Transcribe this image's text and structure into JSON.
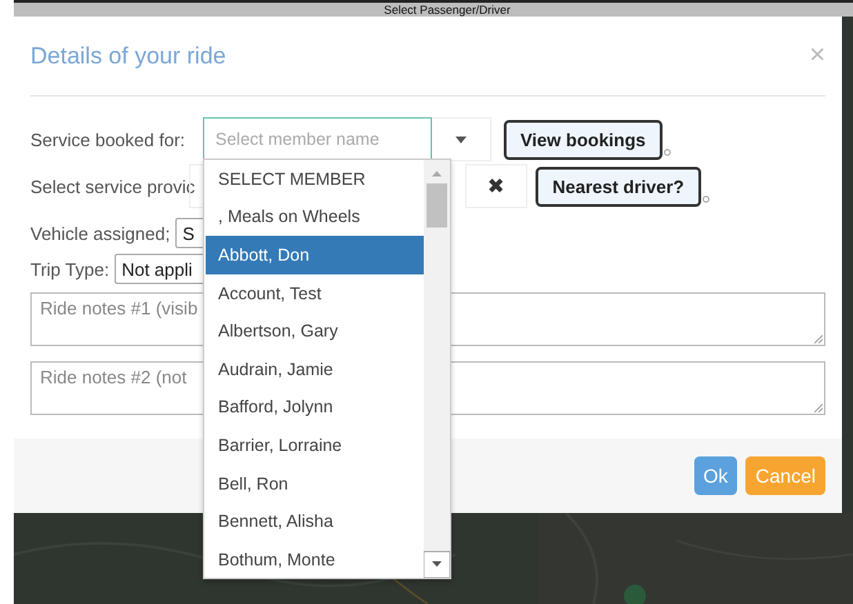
{
  "page_header": {
    "title": "Select Passenger/Driver"
  },
  "dialog": {
    "title": "Details of your ride",
    "close": "×"
  },
  "form": {
    "service_booked_for": {
      "label": "Service booked for:",
      "placeholder": "Select member name"
    },
    "view_bookings": "View bookings",
    "service_provider": {
      "label": "Select service provic",
      "clear": "✖"
    },
    "nearest_driver": "Nearest driver?",
    "vehicle": {
      "label": "Vehicle assigned;",
      "value": "S"
    },
    "trip_type": {
      "label": "Trip Type:",
      "value": "Not appli"
    },
    "notes": [
      {
        "placeholder": "Ride notes #1 (visib"
      },
      {
        "placeholder": "Ride notes #2 (not"
      }
    ]
  },
  "member_dropdown": {
    "items": [
      {
        "label": "SELECT MEMBER",
        "selected": false
      },
      {
        "label": ", Meals on Wheels",
        "selected": false
      },
      {
        "label": "Abbott, Don",
        "selected": true
      },
      {
        "label": "Account, Test",
        "selected": false
      },
      {
        "label": "Albertson, Gary",
        "selected": false
      },
      {
        "label": "Audrain, Jamie",
        "selected": false
      },
      {
        "label": "Bafford, Jolynn",
        "selected": false
      },
      {
        "label": "Barrier, Lorraine",
        "selected": false
      },
      {
        "label": "Bell, Ron",
        "selected": false
      },
      {
        "label": "Bennett, Alisha",
        "selected": false
      },
      {
        "label": "Bothum, Monte",
        "selected": false
      }
    ]
  },
  "buttons": [
    {
      "label": "Ok",
      "kind": "primary"
    },
    {
      "label": "Cancel",
      "kind": "warning"
    }
  ]
}
